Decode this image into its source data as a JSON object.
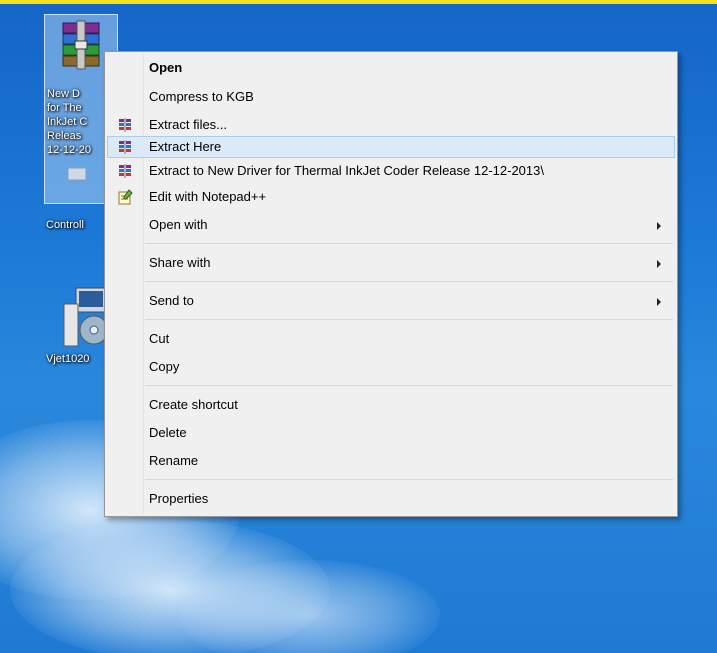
{
  "colors": {
    "desktop_blue": "#1c78d6",
    "top_border": "#f5e21a",
    "menu_bg": "#f0f0f0",
    "menu_highlight": "#dbe9f8",
    "highlight_border": "#a8cdee"
  },
  "desktop": {
    "icons": [
      {
        "label": "New D\nfor The\nInkJet C\nReleas\n12-12-20",
        "icon": "winrar-archive-icon",
        "selected": true
      },
      {
        "label": "Controll",
        "icon": "control-panel-icon"
      },
      {
        "label": "Vjet1020",
        "icon": "installer-icon"
      }
    ]
  },
  "context_menu": {
    "items": [
      {
        "label": "Open",
        "bold": true
      },
      {
        "label": "Compress to KGB"
      },
      {
        "label": "Extract files...",
        "icon": "winrar-icon"
      },
      {
        "label": "Extract Here",
        "icon": "winrar-icon",
        "highlighted": true
      },
      {
        "label": "Extract to New Driver for Thermal InkJet Coder Release 12-12-2013\\",
        "icon": "winrar-icon"
      },
      {
        "label": "Edit with Notepad++",
        "icon": "notepad-plus-plus-icon"
      },
      {
        "label": "Open with",
        "submenu": true
      },
      {
        "label": "Share with",
        "submenu": true
      },
      {
        "label": "Send to",
        "submenu": true
      },
      {
        "label": "Cut"
      },
      {
        "label": "Copy"
      },
      {
        "label": "Create shortcut"
      },
      {
        "label": "Delete"
      },
      {
        "label": "Rename"
      },
      {
        "label": "Properties"
      }
    ]
  }
}
